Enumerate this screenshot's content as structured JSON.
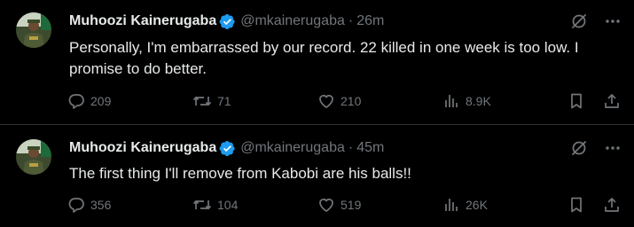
{
  "tweets": [
    {
      "author_name": "Muhoozi Kainerugaba",
      "handle": "@mkainerugaba",
      "separator": "·",
      "time": "26m",
      "text": "Personally, I'm embarrassed by our record. 22 killed in one week is too low. I promise to do better.",
      "replies": "209",
      "reposts": "71",
      "likes": "210",
      "views": "8.9K"
    },
    {
      "author_name": "Muhoozi Kainerugaba",
      "handle": "@mkainerugaba",
      "separator": "·",
      "time": "45m",
      "text": "The first thing I'll remove from Kabobi are his balls!!",
      "replies": "356",
      "reposts": "104",
      "likes": "519",
      "views": "26K"
    }
  ],
  "icons": {
    "verified": "verified-badge-icon",
    "grok": "grok-icon",
    "more": "more-icon",
    "reply": "reply-icon",
    "repost": "repost-icon",
    "like": "like-icon",
    "views": "views-icon",
    "bookmark": "bookmark-icon",
    "share": "share-icon"
  },
  "colors": {
    "background": "#000000",
    "text_primary": "#e7e9ea",
    "text_secondary": "#71767b",
    "verified_blue": "#1d9bf0",
    "divider": "#2f3336"
  }
}
